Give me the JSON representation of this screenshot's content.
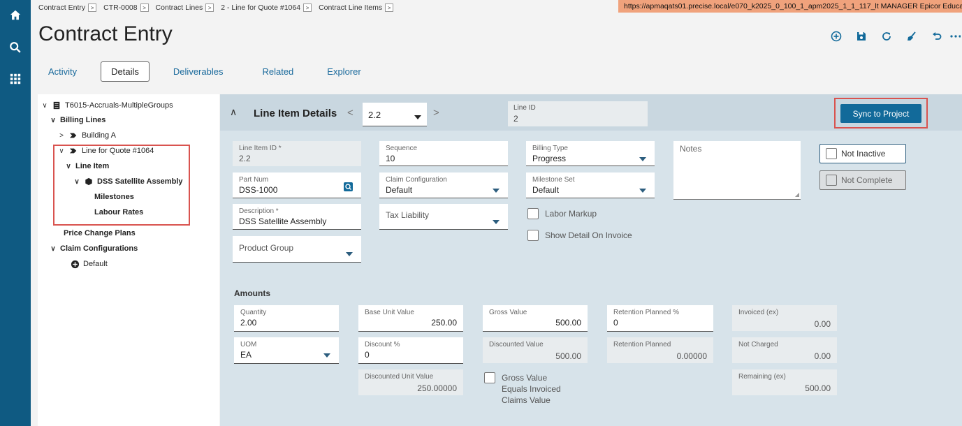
{
  "breadcrumb": [
    {
      "label": "Contract Entry"
    },
    {
      "label": "CTR-0008"
    },
    {
      "label": "Contract Lines"
    },
    {
      "label": "2 - Line for Quote #1064"
    },
    {
      "label": "Contract Line Items"
    }
  ],
  "url_bar": "https://apmaqats01.precise.local/e070_k2025_0_100_1_apm2025_1_1_117_lt  MANAGER  Epicor Educat",
  "page_title": "Contract Entry",
  "tabs": [
    {
      "label": "Activity"
    },
    {
      "label": "Details",
      "active": true
    },
    {
      "label": "Deliverables"
    },
    {
      "label": "Related"
    },
    {
      "label": "Explorer"
    }
  ],
  "tree": {
    "root": "T6015-Accruals-MultipleGroups",
    "billing_lines": "Billing Lines",
    "building_a": "Building A",
    "line_for_quote": "Line for Quote #1064",
    "line_item": "Line Item",
    "dss_assembly": "DSS Satellite Assembly",
    "milestones": "Milestones",
    "labour_rates": "Labour Rates",
    "price_change_plans": "Price Change Plans",
    "claim_configurations": "Claim Configurations",
    "default": "Default"
  },
  "panel": {
    "title": "Line Item Details",
    "selector_value": "2.2",
    "line_id_label": "Line ID",
    "line_id_value": "2",
    "sync_button": "Sync to Project"
  },
  "form": {
    "line_item_id": {
      "label": "Line Item ID *",
      "value": "2.2"
    },
    "sequence": {
      "label": "Sequence",
      "value": "10"
    },
    "billing_type": {
      "label": "Billing Type",
      "value": "Progress"
    },
    "notes": {
      "label": "Notes"
    },
    "not_inactive": "Not Inactive",
    "not_complete": "Not Complete",
    "part_num": {
      "label": "Part Num",
      "value": "DSS-1000"
    },
    "claim_configuration": {
      "label": "Claim Configuration",
      "value": "Default"
    },
    "milestone_set": {
      "label": "Milestone Set",
      "value": "Default"
    },
    "description": {
      "label": "Description *",
      "value": "DSS Satellite Assembly"
    },
    "tax_liability": {
      "label": "Tax Liability"
    },
    "labor_markup": "Labor Markup",
    "show_detail_on_invoice": "Show Detail On Invoice",
    "product_group": {
      "label": "Product Group"
    }
  },
  "amounts": {
    "section_label": "Amounts",
    "quantity": {
      "label": "Quantity",
      "value": "2.00"
    },
    "base_unit_value": {
      "label": "Base Unit Value",
      "value": "250.00"
    },
    "gross_value": {
      "label": "Gross Value",
      "value": "500.00"
    },
    "retention_planned_pct": {
      "label": "Retention Planned %",
      "value": "0"
    },
    "invoiced_ex": {
      "label": "Invoiced (ex)",
      "value": "0.00"
    },
    "uom": {
      "label": "UOM",
      "value": "EA"
    },
    "discount_pct": {
      "label": "Discount %",
      "value": "0"
    },
    "discounted_value": {
      "label": "Discounted Value",
      "value": "500.00"
    },
    "retention_planned": {
      "label": "Retention Planned",
      "value": "0.00000"
    },
    "not_charged": {
      "label": "Not Charged",
      "value": "0.00"
    },
    "discounted_unit_value": {
      "label": "Discounted Unit Value",
      "value": "250.00000"
    },
    "gross_equals_invoiced": "Gross Value Equals Invoiced Claims Value",
    "remaining_ex": {
      "label": "Remaining (ex)",
      "value": "500.00"
    }
  },
  "colors": {
    "nav_rail": "#0f5a82",
    "accent": "#126a9a",
    "highlight": "#d9534f",
    "url_bar": "#f0a27c"
  }
}
